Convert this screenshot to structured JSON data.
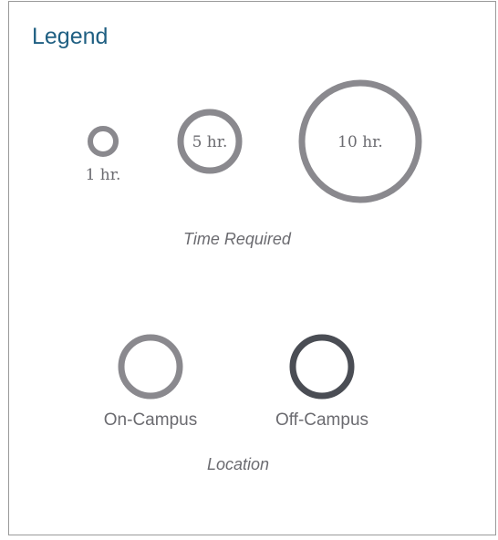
{
  "legend": {
    "title": "Legend"
  },
  "time_required": {
    "caption": "Time Required",
    "items": [
      {
        "label": "1 hr.",
        "hours": 1
      },
      {
        "label": "5 hr.",
        "hours": 5
      },
      {
        "label": "10 hr.",
        "hours": 10
      }
    ],
    "stroke_color": "#8a898e"
  },
  "location": {
    "caption": "Location",
    "items": [
      {
        "label": "On-Campus",
        "color": "#8a898e"
      },
      {
        "label": "Off-Campus",
        "color": "#4a4d54"
      }
    ]
  }
}
